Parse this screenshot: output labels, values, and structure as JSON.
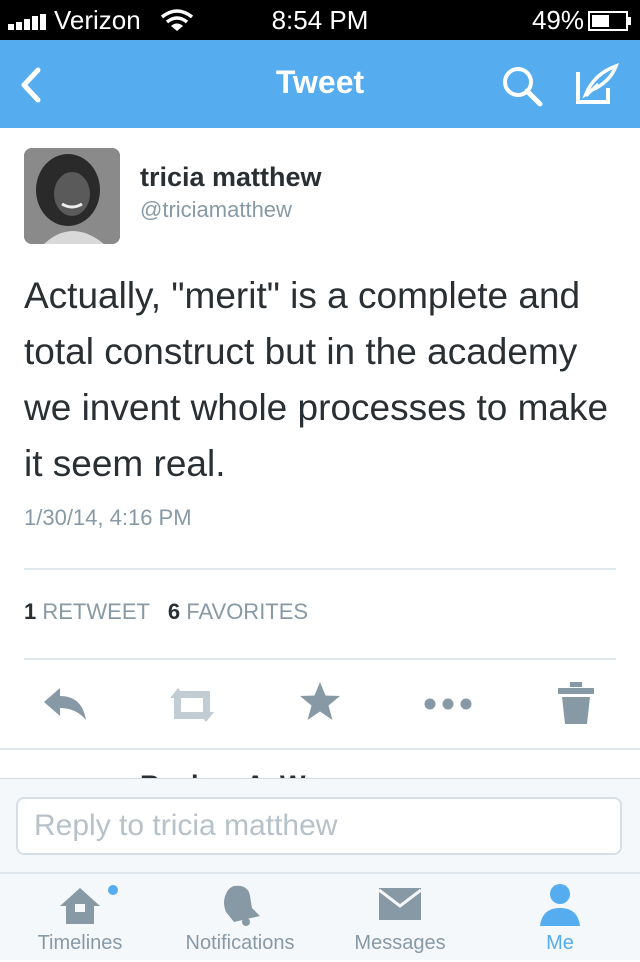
{
  "status_bar": {
    "carrier": "Verizon",
    "time": "8:54 PM",
    "battery": "49%"
  },
  "nav": {
    "title": "Tweet"
  },
  "tweet": {
    "author_name": "tricia matthew",
    "author_handle": "@triciamatthew",
    "text": "Actually, \"merit\" is a complete and total construct but in the academy we invent whole processes to make it seem real.",
    "timestamp": "1/30/14, 4:16 PM",
    "retweet_count": "1",
    "retweet_label": "RETWEET",
    "favorites_count": "6",
    "favorites_label": "FAVORITES"
  },
  "reply_preview": {
    "author_partial": "Reuben A. Warner"
  },
  "reply": {
    "placeholder": "Reply to tricia matthew"
  },
  "tabs": [
    {
      "label": "Timelines",
      "icon": "home-icon",
      "notification_dot": true
    },
    {
      "label": "Notifications",
      "icon": "bell-icon"
    },
    {
      "label": "Messages",
      "icon": "envelope-icon"
    },
    {
      "label": "Me",
      "icon": "person-icon",
      "active": true
    }
  ],
  "colors": {
    "brand": "#55acee",
    "text": "#292f33",
    "muted": "#8899a6"
  }
}
